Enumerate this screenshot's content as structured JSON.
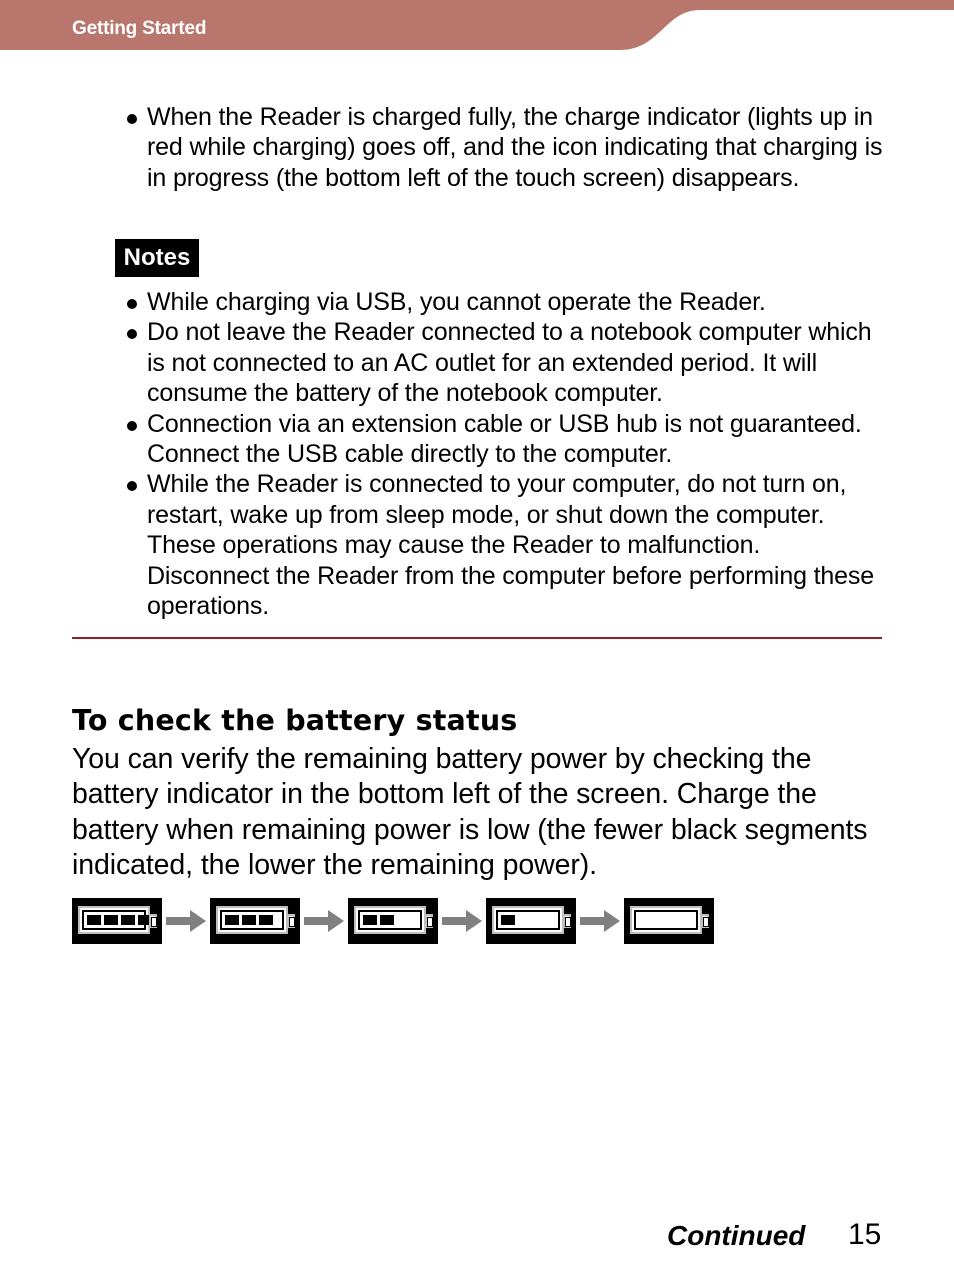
{
  "header": {
    "section_title": "Getting Started",
    "band_color": "#b8766c"
  },
  "intro_bullets": [
    "When the Reader is charged fully, the charge indicator (lights up in red while charging) goes off, and the icon indicating that charging is in progress (the bottom left of the touch screen) disappears."
  ],
  "notes": {
    "badge_label": "Notes",
    "items": [
      "While charging via USB, you cannot operate the Reader.",
      "Do not leave the Reader connected to a notebook computer which is not connected to an AC outlet for an extended period. It will consume the battery of the notebook computer.",
      "Connection via an extension cable or USB hub is not guaranteed. Connect the USB cable directly to the computer.",
      "While the Reader is connected to your computer, do not turn on, restart, wake up from sleep mode, or shut down the computer. These operations may cause the Reader to malfunction. Disconnect the Reader from the computer before performing these operations."
    ]
  },
  "divider_color": "#8b2326",
  "battery_section": {
    "title": "To check the battery status",
    "body": "You can verify the remaining battery power by checking the battery indicator in the bottom left of the screen. Charge the battery when remaining power is low (the fewer black segments indicated, the lower the remaining power).",
    "indicators": [
      {
        "icon": "battery-full-icon",
        "segments": 4,
        "max_segments": 4
      },
      {
        "icon": "battery-three-quarter-icon",
        "segments": 3,
        "max_segments": 4
      },
      {
        "icon": "battery-half-icon",
        "segments": 2,
        "max_segments": 4
      },
      {
        "icon": "battery-low-icon",
        "segments": 1,
        "max_segments": 4
      },
      {
        "icon": "battery-empty-icon",
        "segments": 0,
        "max_segments": 4
      }
    ],
    "arrow_icon": "arrow-right-icon",
    "arrow_color": "#808080"
  },
  "footer": {
    "continued_label": "Continued",
    "page_number": "15"
  }
}
